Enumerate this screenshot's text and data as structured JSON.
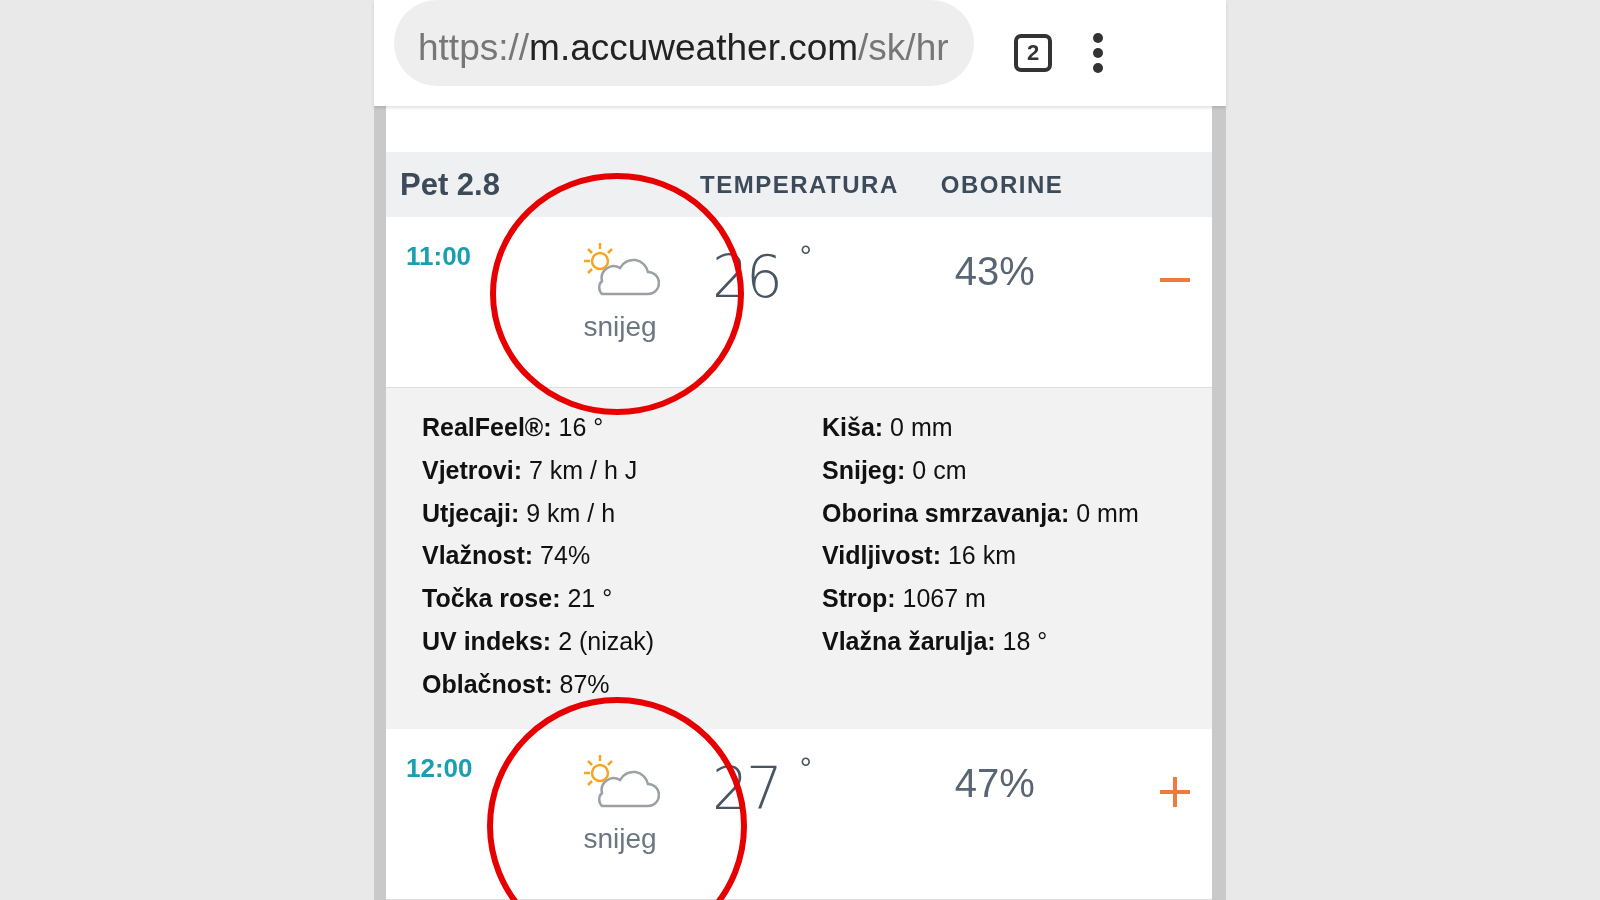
{
  "browser": {
    "url_prefix": "https://",
    "url_host": "m.accuweather.com",
    "url_path": "/sk/hr",
    "tab_count": "2"
  },
  "forecast": {
    "day": "Pet 2.8",
    "columns": [
      "TEMPERATURA",
      "OBORINE"
    ],
    "hours": [
      {
        "time": "11:00",
        "condition": "snijeg",
        "temperature": "26",
        "degree": "°",
        "precipitation": "43%",
        "expanded": true,
        "details_left": [
          "**RealFeel®:** 16 °",
          "**Vjetrovi:** 7 km / h J",
          "**Utjecaji:** 9 km / h",
          "**Vlažnost:** 74%",
          "**Točka rose:** 21 °",
          "**UV indeks:** 2 (nizak)",
          "**Oblačnost:** 87%"
        ],
        "details_right": [
          "**Kiša:** 0 mm",
          "**Snijeg:** 0 cm",
          "**Oborina smrzavanja:** 0 mm",
          "**Vidljivost:** 16 km",
          "**Strop:** 1067 m",
          "**Vlažna žarulja:** 18 °"
        ]
      },
      {
        "time": "12:00",
        "condition": "snijeg",
        "temperature": "27",
        "degree": "°",
        "precipitation": "47%",
        "expanded": false
      }
    ]
  }
}
